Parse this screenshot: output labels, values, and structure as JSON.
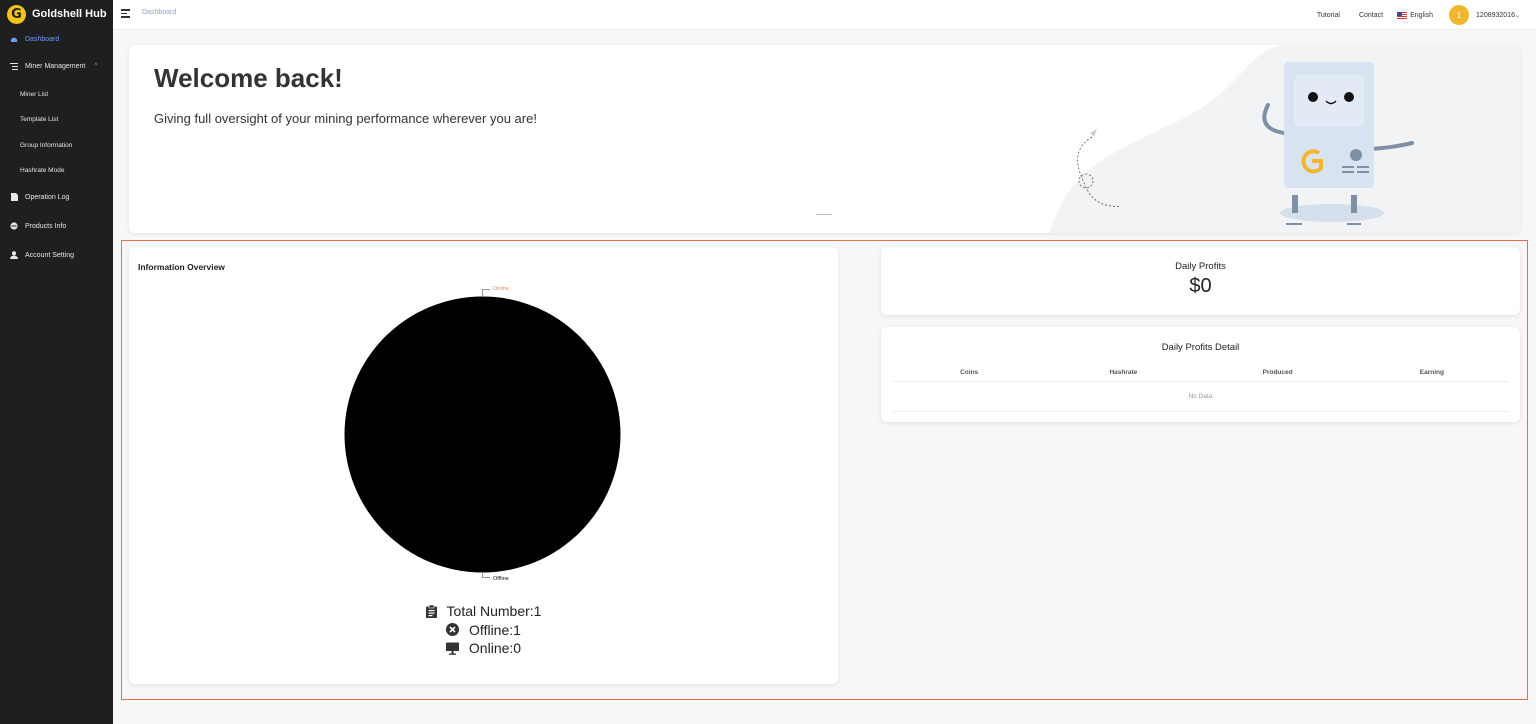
{
  "brand": {
    "logo_letter": "G",
    "name": "Goldshell Hub",
    "accent": "#f0c419"
  },
  "sidebar": {
    "items": [
      {
        "label": "Dashboard",
        "icon": "dashboard-icon",
        "active": true
      },
      {
        "label": "Miner Management",
        "icon": "list-icon"
      },
      {
        "label": "Miner List"
      },
      {
        "label": "Template List"
      },
      {
        "label": "Group Information"
      },
      {
        "label": "Hashrate Mode"
      },
      {
        "label": "Operation Log",
        "icon": "document-icon"
      },
      {
        "label": "Products Info",
        "icon": "product-icon"
      },
      {
        "label": "Account Setting",
        "icon": "user-icon"
      }
    ]
  },
  "topbar": {
    "breadcrumb": "Dashboard",
    "tutorial": "Tutorial",
    "contact": "Contact",
    "language": "English",
    "avatar_initial": "1",
    "user_id": "1208932016"
  },
  "banner": {
    "title": "Welcome back!",
    "subtitle": "Giving full oversight of your mining performance wherever you are!"
  },
  "overview": {
    "title": "Information Overview",
    "total": "Total Number:1",
    "offline": "Offline:1",
    "online": "Online:0"
  },
  "chart_data": {
    "type": "pie",
    "categories": [
      "Online",
      "Offline"
    ],
    "values": [
      0,
      1
    ],
    "colors": [
      "#d98a5f",
      "#000000"
    ]
  },
  "profits": {
    "title": "Daily Profits",
    "value": "$0"
  },
  "detail": {
    "title": "Daily Profits Detail",
    "columns": [
      "Coins",
      "Hashrate",
      "Produced",
      "Earning"
    ],
    "empty": "No Data"
  }
}
